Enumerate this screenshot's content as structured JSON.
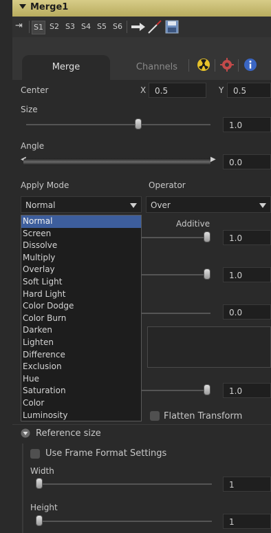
{
  "header": {
    "title": "Merge1"
  },
  "toolbar": {
    "slots": [
      "S1",
      "S2",
      "S3",
      "S4",
      "S5",
      "S6"
    ],
    "active_slot": "S1"
  },
  "tabs": {
    "merge": "Merge",
    "channels": "Channels"
  },
  "center": {
    "label": "Center",
    "x_label": "X",
    "x_value": "0.5",
    "y_label": "Y",
    "y_value": "0.5"
  },
  "size": {
    "label": "Size",
    "value": "1.0"
  },
  "angle": {
    "label": "Angle",
    "value": "0.0"
  },
  "apply_mode": {
    "label": "Apply Mode",
    "value": "Normal"
  },
  "operator": {
    "label": "Operator",
    "value": "Over"
  },
  "blend_modes": [
    "Normal",
    "Screen",
    "Dissolve",
    "Multiply",
    "Overlay",
    "Soft Light",
    "Hard Light",
    "Color Dodge",
    "Color Burn",
    "Darken",
    "Lighten",
    "Difference",
    "Exclusion",
    "Hue",
    "Saturation",
    "Color",
    "Luminosity"
  ],
  "additive": {
    "label": "Additive",
    "value": "1.0"
  },
  "row2_value": "1.0",
  "row3_value": "0.0",
  "row4_value": "1.0",
  "flatten": {
    "label": "Flatten Transform"
  },
  "reference": {
    "label": "Reference size",
    "use_frame": "Use Frame Format Settings",
    "width_label": "Width",
    "width_value": "1",
    "height_label": "Height",
    "height_value": "1"
  }
}
